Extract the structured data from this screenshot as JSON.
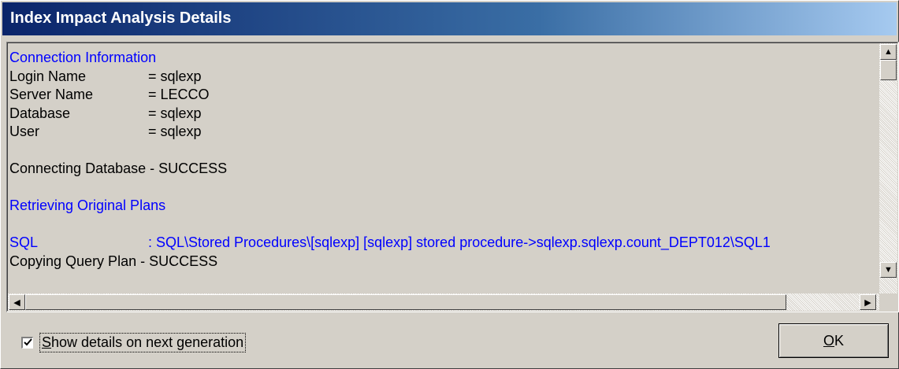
{
  "window": {
    "title": "Index Impact Analysis Details"
  },
  "log": {
    "lines": [
      {
        "text": "Connection Information",
        "color": "#0000ff"
      },
      {
        "key": "Login Name",
        "value": "= sqlexp"
      },
      {
        "key": "Server Name",
        "value": "= LECCO"
      },
      {
        "key": "Database",
        "value": "= sqlexp"
      },
      {
        "key": "User",
        "value": "= sqlexp"
      },
      {
        "text": ""
      },
      {
        "text": "Connecting Database - SUCCESS"
      },
      {
        "text": ""
      },
      {
        "text": "Retrieving Original Plans",
        "color": "#0000ff"
      },
      {
        "text": ""
      },
      {
        "key": "SQL",
        "value": ": SQL\\Stored Procedures\\[sqlexp] [sqlexp] stored procedure->sqlexp.sqlexp.count_DEPT012\\SQL1",
        "color": "#0000ff"
      },
      {
        "text": "Copying Query Plan - SUCCESS"
      }
    ]
  },
  "scrollbars": {
    "up_arrow": "▲",
    "down_arrow": "▼",
    "left_arrow": "◀",
    "right_arrow": "▶",
    "up_arrow_icon": "arrow-up-icon",
    "down_arrow_icon": "arrow-down-icon",
    "left_arrow_icon": "arrow-left-icon",
    "right_arrow_icon": "arrow-right-icon"
  },
  "options": {
    "show_details_label": "Show details on next generation",
    "show_details_checked": true
  },
  "buttons": {
    "ok_label": "OK"
  }
}
